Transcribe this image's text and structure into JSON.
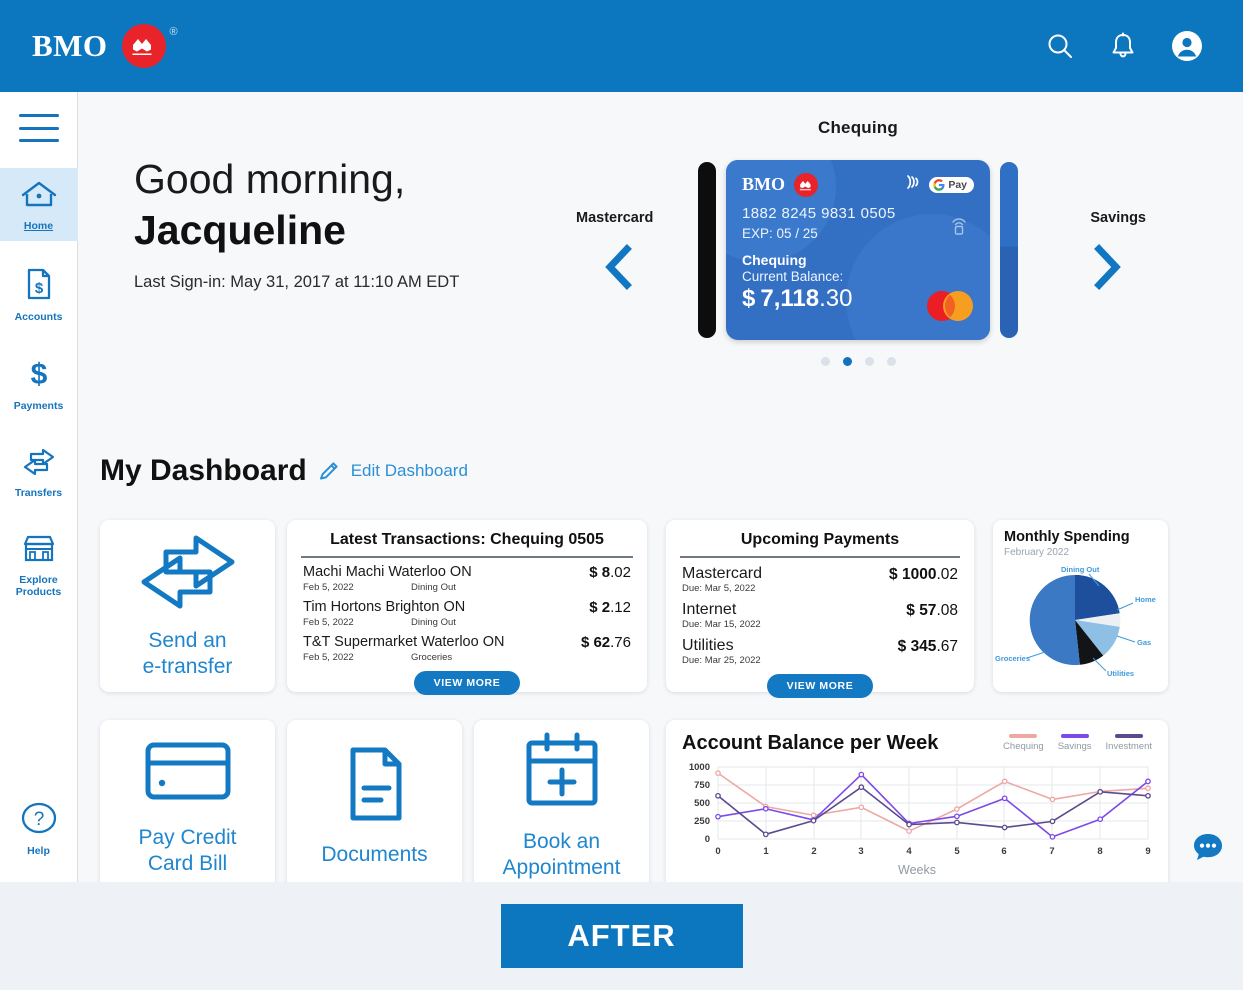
{
  "brand": {
    "name": "BMO",
    "registered": "®"
  },
  "header": {
    "icons": [
      {
        "name": "search-icon",
        "label": "Search"
      },
      {
        "name": "bell-icon",
        "label": "Notifications"
      },
      {
        "name": "account-avatar-icon",
        "label": "Profile"
      }
    ]
  },
  "sidebar": {
    "menu_label": "Menu",
    "items": [
      {
        "label": "Home",
        "icon": "home-icon",
        "active": true
      },
      {
        "label": "Accounts",
        "icon": "document-dollar-icon",
        "active": false
      },
      {
        "label": "Payments",
        "icon": "dollar-sign-icon",
        "active": false
      },
      {
        "label": "Transfers",
        "icon": "two-way-arrows-icon",
        "active": false
      },
      {
        "label": "Explore Products",
        "icon": "storefront-icon",
        "active": false
      }
    ],
    "help": {
      "label": "Help",
      "icon": "question-circle-icon"
    }
  },
  "greeting": {
    "line1": "Good morning,",
    "name": "Jacqueline",
    "last_signin": "Last Sign-in: May 31, 2017 at 11:10 AM EDT"
  },
  "carousel": {
    "title": "Chequing",
    "prev_label": "Mastercard",
    "next_label": "Savings",
    "prev_icon": "chevron-left-icon",
    "next_icon": "chevron-right-icon",
    "dots_total": 4,
    "dots_active_index": 1,
    "card": {
      "brand": "BMO",
      "number": "1882 8245 9831 0505",
      "expiry_label": "EXP: 05 / 25",
      "account_type": "Chequing",
      "balance_label": "Current Balance:",
      "currency": "$",
      "amount_major": "7,118",
      "amount_minor": ".30",
      "wallet_label": "Pay",
      "contactless_icon": "contactless-icon",
      "network_icon": "mastercard-logo",
      "card_bg": "#3370c4"
    }
  },
  "dashboard": {
    "title": "My Dashboard",
    "edit_label": "Edit Dashboard",
    "edit_icon": "pencil-icon"
  },
  "etransfer_tile": {
    "label_line1": "Send an",
    "label_line2": "e-transfer",
    "icon": "two-way-arrows-icon"
  },
  "transactions": {
    "title": "Latest Transactions: Chequing 0505",
    "rows": [
      {
        "name": "Machi Machi Waterloo ON",
        "date": "Feb 5, 2022",
        "category": "Dining Out",
        "currency": "$",
        "amount_major": "8",
        "amount_minor": ".02"
      },
      {
        "name": "Tim Hortons Brighton ON",
        "date": "Feb 5, 2022",
        "category": "Dining Out",
        "currency": "$",
        "amount_major": "2",
        "amount_minor": ".12"
      },
      {
        "name": "T&T Supermarket Waterloo ON",
        "date": "Feb 5, 2022",
        "category": "Groceries",
        "currency": "$",
        "amount_major": "62",
        "amount_minor": ".76"
      }
    ],
    "view_more": "VIEW MORE"
  },
  "upcoming": {
    "title": "Upcoming Payments",
    "rows": [
      {
        "name": "Mastercard",
        "due": "Due: Mar 5, 2022",
        "currency": "$",
        "amount_major": "1000",
        "amount_minor": ".02"
      },
      {
        "name": "Internet",
        "due": "Due: Mar 15, 2022",
        "currency": "$",
        "amount_major": "57",
        "amount_minor": ".08"
      },
      {
        "name": "Utilities",
        "due": "Due: Mar 25, 2022",
        "currency": "$",
        "amount_major": "345",
        "amount_minor": ".67"
      }
    ],
    "view_more": "VIEW MORE"
  },
  "action_tiles": [
    {
      "label_line1": "Pay Credit",
      "label_line2": "Card Bill",
      "icon": "credit-card-icon"
    },
    {
      "label_line1": "Documents",
      "label_line2": "",
      "icon": "document-icon"
    },
    {
      "label_line1": "Book an",
      "label_line2": "Appointment",
      "icon": "calendar-plus-icon"
    }
  ],
  "chat": {
    "icon": "chat-bubble-icon"
  },
  "footer": {
    "after_label": "AFTER"
  },
  "chart_data": [
    {
      "type": "pie",
      "title": "Monthly Spending",
      "subtitle": "February 2022",
      "categories": [
        "Dining Out",
        "Home",
        "Gas",
        "Utilities",
        "Groceries"
      ],
      "values": [
        27,
        17,
        12,
        11,
        33
      ],
      "colors": [
        "#1d4f9c",
        "#edf0f3",
        "#8dc0e4",
        "#121417",
        "#3b79c4"
      ],
      "label_color": "#3f9bdc",
      "legend": "labels-with-leaders"
    },
    {
      "type": "line",
      "title": "Account Balance per Week",
      "xlabel": "Weeks",
      "ylabel": "",
      "x": [
        0,
        1,
        2,
        3,
        4,
        5,
        6,
        7,
        8,
        9
      ],
      "xticks": [
        "0",
        "1",
        "2",
        "3",
        "4",
        "5",
        "6",
        "7",
        "8",
        "9"
      ],
      "yticks": [
        "0",
        "250",
        "500",
        "750",
        "1000"
      ],
      "ylim": [
        0,
        1000
      ],
      "grid": true,
      "legend_position": "top-right",
      "series": [
        {
          "name": "Chequing",
          "color": "#eda8a4",
          "values": [
            915,
            450,
            330,
            440,
            110,
            415,
            800,
            550,
            660,
            705
          ]
        },
        {
          "name": "Savings",
          "color": "#7c4ae8",
          "values": [
            310,
            420,
            265,
            895,
            215,
            315,
            565,
            30,
            275,
            800
          ]
        },
        {
          "name": "Investment",
          "color": "#5c4a8f",
          "values": [
            600,
            65,
            255,
            720,
            200,
            230,
            160,
            245,
            655,
            600
          ]
        }
      ]
    }
  ]
}
